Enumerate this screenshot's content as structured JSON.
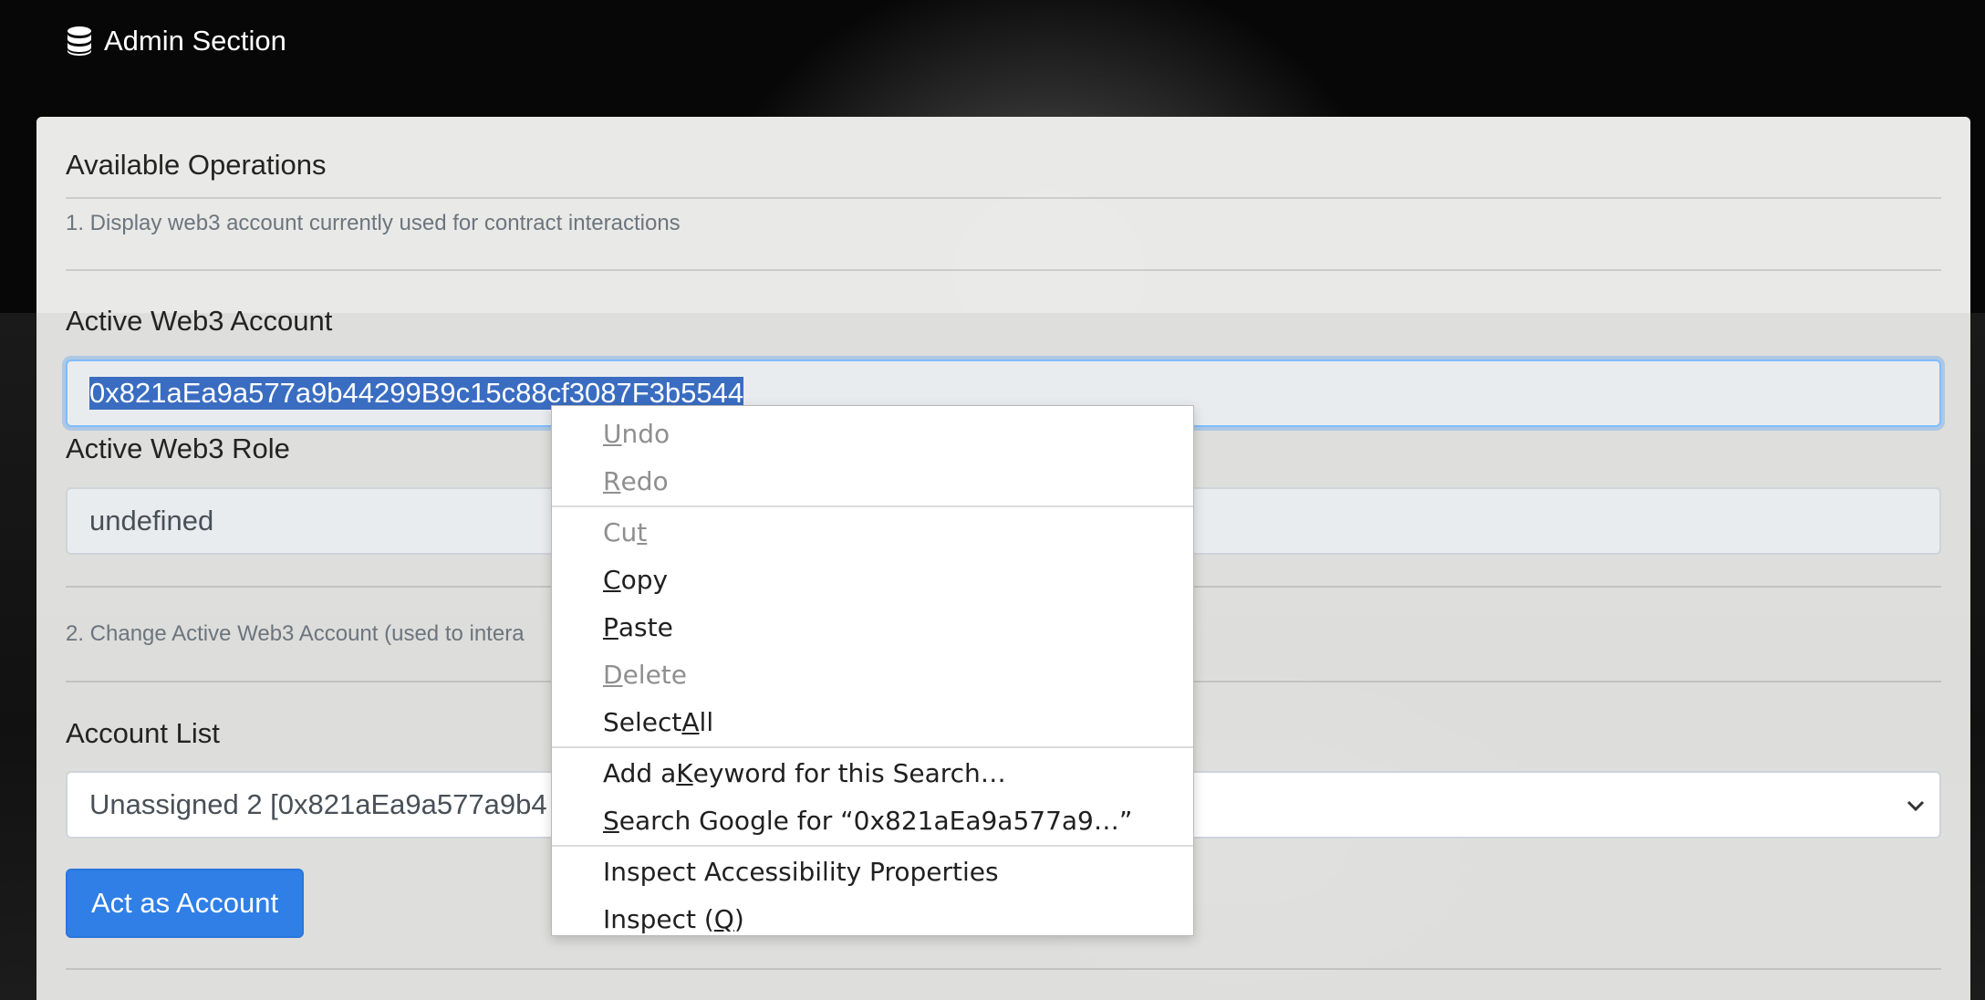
{
  "header": {
    "title": "Admin Section",
    "icon": "database-icon"
  },
  "panel": {
    "title": "Available Operations",
    "op1_description": "1. Display web3 account currently used for contract interactions",
    "active_account_label": "Active Web3 Account",
    "active_account_value": "0x821aEa9a577a9b44299B9c15c88cf3087F3b5544",
    "active_role_label": "Active Web3 Role",
    "active_role_value": "undefined",
    "op2_description": "2. Change Active Web3 Account (used to intera",
    "account_list_label": "Account List",
    "account_list_selected": "Unassigned 2 [0x821aEa9a577a9b4",
    "act_button": "Act as Account"
  },
  "context_menu": {
    "undo": {
      "pre": "",
      "key": "U",
      "post": "ndo"
    },
    "redo": {
      "pre": "",
      "key": "R",
      "post": "edo"
    },
    "cut": {
      "pre": "Cu",
      "key": "t",
      "post": ""
    },
    "copy": {
      "pre": "",
      "key": "C",
      "post": "opy"
    },
    "paste": {
      "pre": "",
      "key": "P",
      "post": "aste"
    },
    "delete": {
      "pre": "",
      "key": "D",
      "post": "elete"
    },
    "select_all": {
      "pre": "Select ",
      "key": "A",
      "post": "ll"
    },
    "add_keyword": {
      "pre": "Add a ",
      "key": "K",
      "post": "eyword for this Search…"
    },
    "search_google": {
      "pre": "",
      "key": "S",
      "post": "earch Google for “0x821aEa9a577a9…”"
    },
    "inspect_accessibility": "Inspect Accessibility Properties",
    "inspect": {
      "pre": "Inspect (",
      "key": "Q",
      "post": ")"
    }
  },
  "colors": {
    "primary_button": "#2f7fe6",
    "selection": "#3a6dc1"
  }
}
